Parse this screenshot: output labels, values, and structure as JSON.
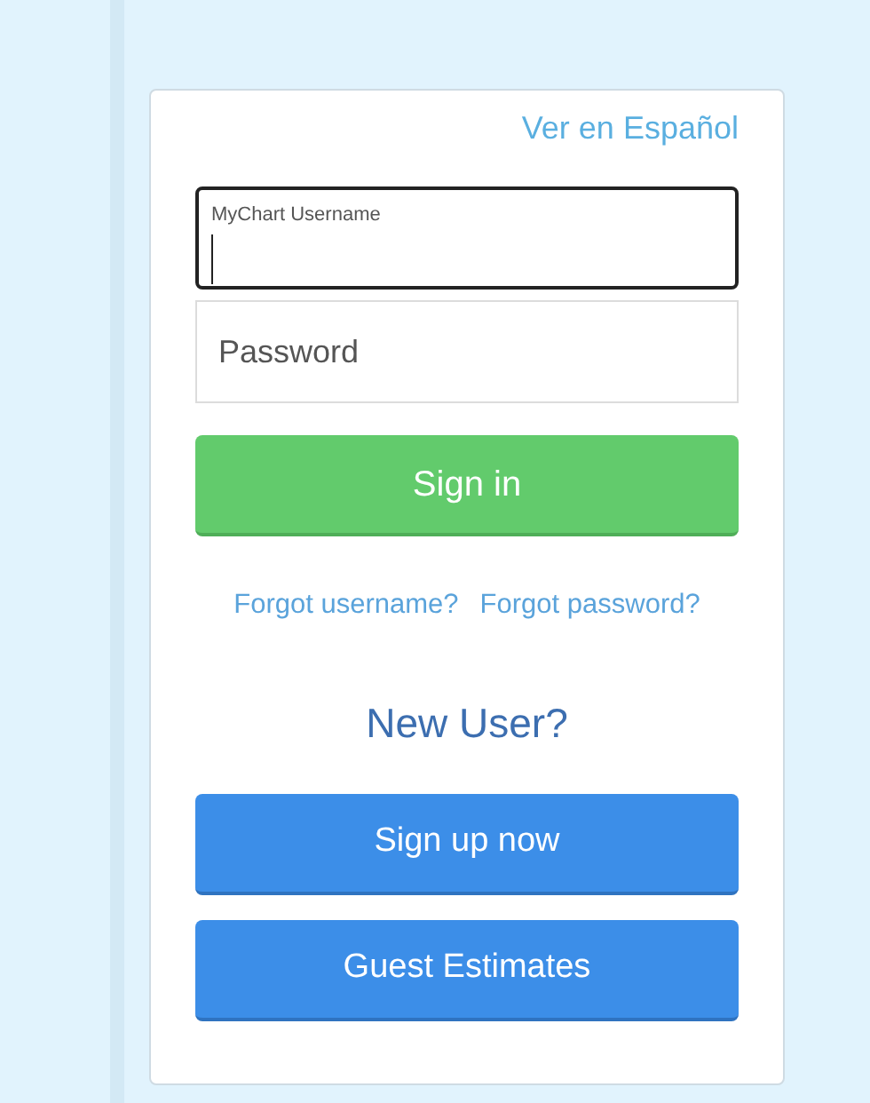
{
  "language_link": "Ver en Español",
  "fields": [
    {
      "kind": "floating",
      "label": "MyChart Username",
      "focused": true
    },
    {
      "kind": "plain",
      "placeholder": "Password",
      "focused": false
    }
  ],
  "sign_in_button": "Sign in",
  "links": [
    "Forgot username?",
    "Forgot password?"
  ],
  "new_user_heading": "New User?",
  "buttons": [
    "Sign up now",
    "Guest Estimates"
  ]
}
